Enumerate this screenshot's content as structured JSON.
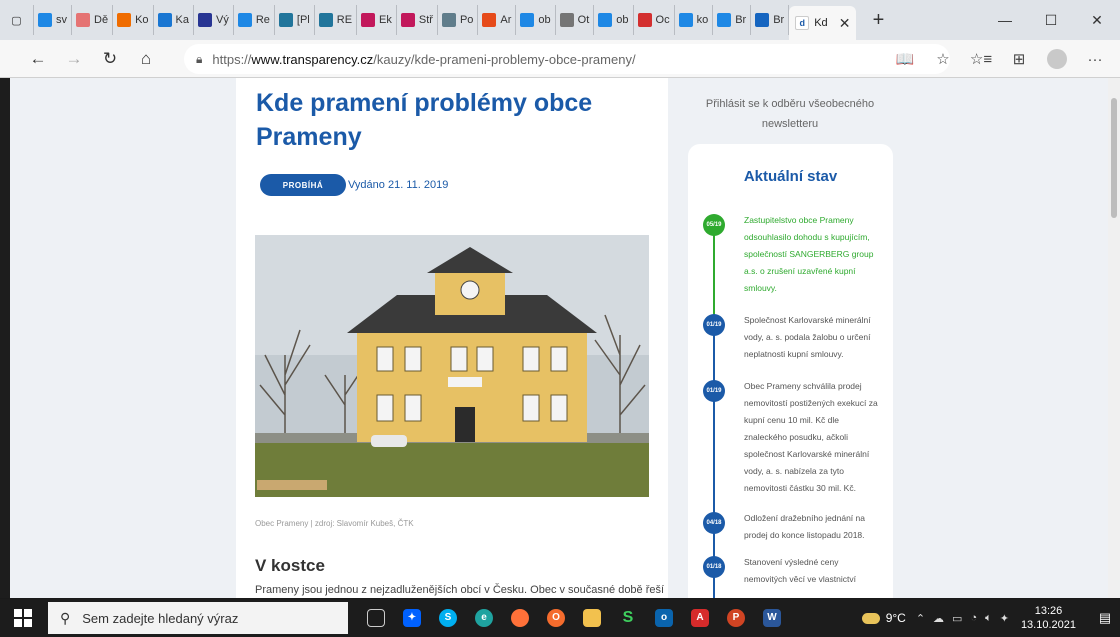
{
  "browser": {
    "tabs": [
      {
        "label": "sv",
        "icon": "bing-icon",
        "color": "#1e88e5"
      },
      {
        "label": "Dě",
        "icon": "cupcake-icon",
        "color": "#e57373"
      },
      {
        "label": "Ko",
        "icon": "pen-icon",
        "color": "#ef6c00"
      },
      {
        "label": "Ka",
        "icon": "calendar-icon",
        "color": "#1976d2"
      },
      {
        "label": "Vý",
        "icon": "m-icon",
        "color": "#283593"
      },
      {
        "label": "Re",
        "icon": "bing-icon",
        "color": "#1e88e5"
      },
      {
        "label": "[Pl",
        "icon": "wordpress-icon",
        "color": "#21759b"
      },
      {
        "label": "RE",
        "icon": "wordpress-icon",
        "color": "#21759b"
      },
      {
        "label": "Ek",
        "icon": "m-icon",
        "color": "#c2185b"
      },
      {
        "label": "Stř",
        "icon": "m-icon",
        "color": "#c2185b"
      },
      {
        "label": "Po",
        "icon": "book-icon",
        "color": "#607d8b"
      },
      {
        "label": "Ar",
        "icon": "app-icon",
        "color": "#e64a19"
      },
      {
        "label": "ob",
        "icon": "bing-icon",
        "color": "#1e88e5"
      },
      {
        "label": "Ot",
        "icon": "page-icon",
        "color": "#757575"
      },
      {
        "label": "ob",
        "icon": "bing-icon",
        "color": "#1e88e5"
      },
      {
        "label": "Oc",
        "icon": "heart-icon",
        "color": "#d32f2f"
      },
      {
        "label": "ko",
        "icon": "bing-icon",
        "color": "#1e88e5"
      },
      {
        "label": "Br",
        "icon": "bing-icon",
        "color": "#1e88e5"
      },
      {
        "label": "Br",
        "icon": "d-icon",
        "color": "#1565c0"
      }
    ],
    "active_tab": {
      "label": "Kd",
      "close": "✕"
    },
    "newtab": "+",
    "window_controls": {
      "minimize": "—",
      "maximize": "☐",
      "close": "✕"
    },
    "nav": {
      "back": "←",
      "forward": "→",
      "reload": "↻",
      "home": "⌂"
    },
    "url": {
      "scheme": "https://",
      "host": "www.transparency.cz",
      "path": "/kauzy/kde-prameni-problemy-obce-prameny/"
    },
    "nav_right": {
      "reader": "📖",
      "favorite": "☆",
      "favorites": "☆≡",
      "collections": "⊞",
      "more": "···"
    }
  },
  "article": {
    "title": "Kde pramení problémy obce Prameny",
    "status_badge": "PROBÍHÁ",
    "published": "Vydáno 21. 11. 2019",
    "photo_caption": "Obec Prameny | zdroj: Slavomír Kubeš, ČTK",
    "section_heading": "V kostce",
    "intro": "Prameny jsou jednou z nejzadluženějších obcí v Česku. Obec v současné době řeší"
  },
  "sidebar": {
    "newsletter": "Přihlásit se k odběru všeobecného newsletteru",
    "state_title": "Aktuální stav",
    "timeline": [
      {
        "date": "05/19",
        "text": "Zastupitelstvo obce Prameny odsouhlasilo dohodu s kupujícím, společností SANGERBERG group a.s. o zrušení uzavřené kupní smlouvy.",
        "color": "#2faa2f"
      },
      {
        "date": "01/19",
        "text": "Společnost Karlovarské minerální vody, a. s. podala žalobu o určení neplatnosti kupní smlouvy.",
        "color": "#555555"
      },
      {
        "date": "01/19",
        "text": "Obec Prameny schválila prodej nemovitostí postižených exekucí za kupní cenu 10 mil. Kč dle znaleckého posudku, ačkoli společnost Karlovarské minerální vody, a. s. nabízela za tyto nemovitosti částku 30 mil. Kč.",
        "color": "#555555"
      },
      {
        "date": "04/18",
        "text": "Odložení dražebního jednání na prodej do konce listopadu 2018.",
        "color": "#555555"
      },
      {
        "date": "01/18",
        "text": "Stanovení výsledné ceny nemovitých věcí ve vlastnictví",
        "color": "#555555"
      }
    ]
  },
  "taskbar": {
    "search_placeholder": "Sem zadejte hledaný výraz",
    "weather": "9°C",
    "time": "13:26",
    "date": "13.10.2021"
  }
}
